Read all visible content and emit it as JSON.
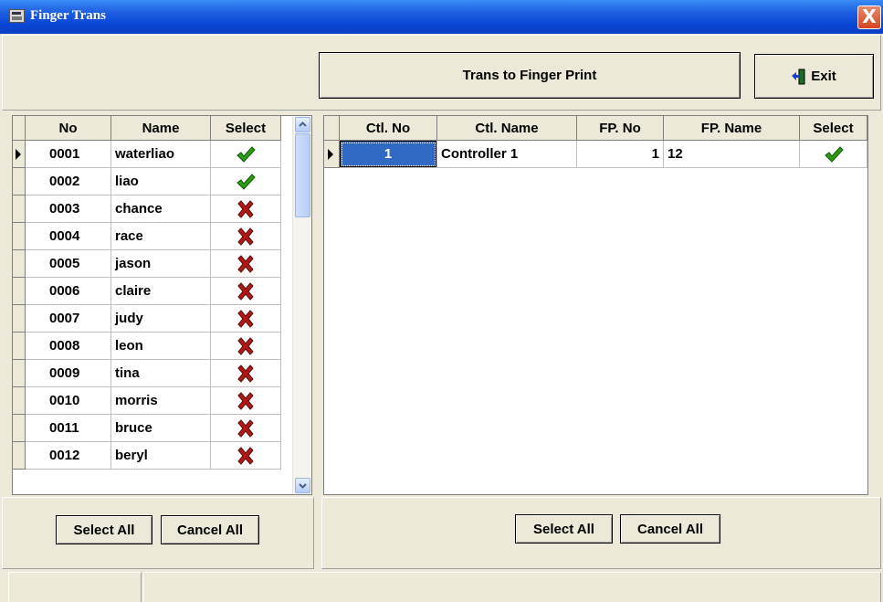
{
  "window": {
    "title": "Finger Trans",
    "close_label": "X"
  },
  "toolbar": {
    "trans_label": "Trans to Finger Print",
    "exit_label": "Exit"
  },
  "users_grid": {
    "columns": [
      "No",
      "Name",
      "Select"
    ],
    "rows": [
      {
        "no": "0001",
        "name": "waterliao",
        "selected": true
      },
      {
        "no": "0002",
        "name": "liao",
        "selected": true
      },
      {
        "no": "0003",
        "name": "chance",
        "selected": false
      },
      {
        "no": "0004",
        "name": "race",
        "selected": false
      },
      {
        "no": "0005",
        "name": "jason",
        "selected": false
      },
      {
        "no": "0006",
        "name": "claire",
        "selected": false
      },
      {
        "no": "0007",
        "name": "judy",
        "selected": false
      },
      {
        "no": "0008",
        "name": "leon",
        "selected": false
      },
      {
        "no": "0009",
        "name": "tina",
        "selected": false
      },
      {
        "no": "0010",
        "name": "morris",
        "selected": false
      },
      {
        "no": "0011",
        "name": "bruce",
        "selected": false
      },
      {
        "no": "0012",
        "name": "beryl",
        "selected": false
      }
    ]
  },
  "controllers_grid": {
    "columns": [
      "Ctl. No",
      "Ctl. Name",
      "FP. No",
      "FP. Name",
      "Select"
    ],
    "rows": [
      {
        "ctl_no": "1",
        "ctl_name": "Controller 1",
        "fp_no": "1",
        "fp_name": "12",
        "selected": true
      }
    ]
  },
  "left_actions": {
    "select_all": "Select All",
    "cancel_all": "Cancel All"
  },
  "right_actions": {
    "select_all": "Select All",
    "cancel_all": "Cancel All"
  },
  "icons": {
    "selected": "check-icon",
    "unselected": "cross-icon",
    "exit": "exit-door-icon",
    "app": "app-icon"
  },
  "colors": {
    "check": "#2e9a16",
    "cross": "#b01818",
    "title_bar": "#0a47d6",
    "highlight": "#316ac5"
  }
}
